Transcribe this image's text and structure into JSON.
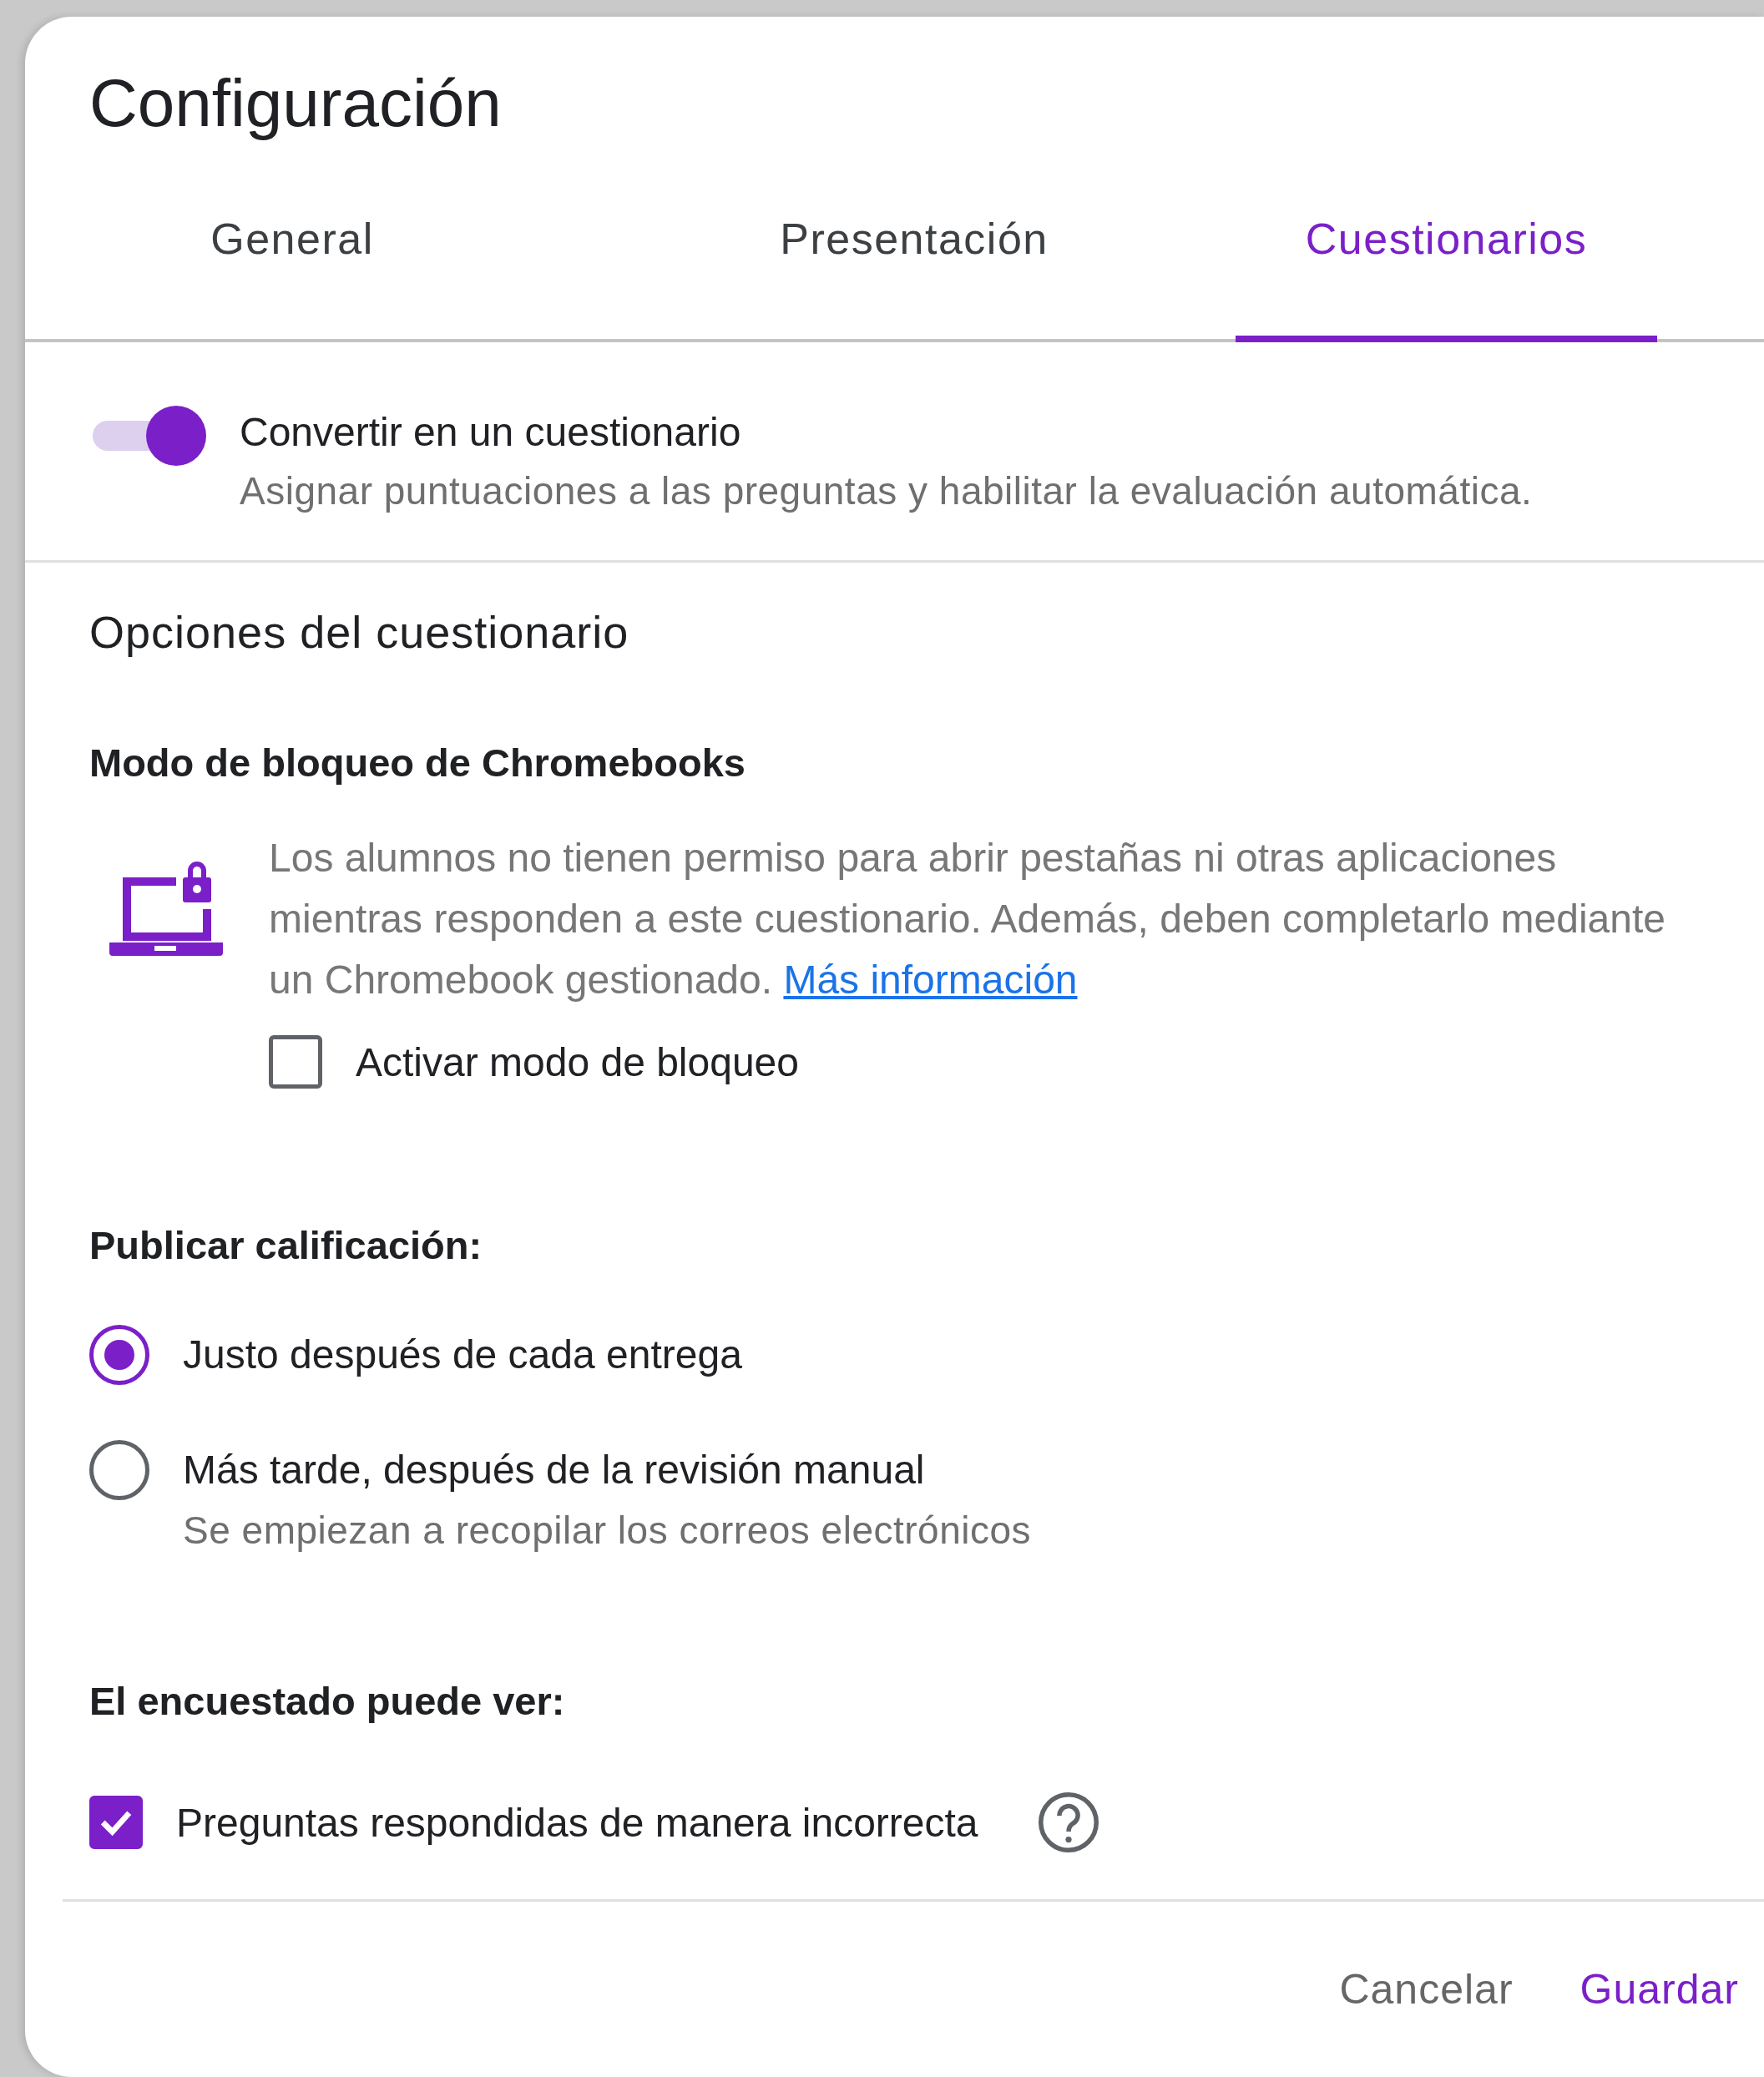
{
  "dialog": {
    "title": "Configuración"
  },
  "tabs": [
    {
      "label": "General",
      "selected": false
    },
    {
      "label": "Presentación",
      "selected": false
    },
    {
      "label": "Cuestionarios",
      "selected": true
    }
  ],
  "quiz_toggle": {
    "label": "Convertir en un cuestionario",
    "description": "Asignar puntuaciones a las preguntas y habilitar la evaluación automática.",
    "on": true
  },
  "section_title": "Opciones del cuestionario",
  "lockdown": {
    "heading": "Modo de bloqueo de Chromebooks",
    "description": "Los alumnos no tienen permiso para abrir pestañas ni otras aplicaciones mientras responden a este cuestionario. Además, deben completarlo mediante un Chromebook gestionado.",
    "link": "Más información",
    "checkbox": {
      "label": "Activar modo de bloqueo",
      "checked": false
    }
  },
  "release_grade": {
    "heading": "Publicar calificación:",
    "options": [
      {
        "label": "Justo después de cada entrega",
        "selected": true
      },
      {
        "label": "Más tarde, después de la revisión manual",
        "sublabel": "Se empiezan a recopilar los correos electrónicos",
        "selected": false
      }
    ]
  },
  "respondent_can_see": {
    "heading": "El encuestado puede ver:",
    "items": [
      {
        "label": "Preguntas respondidas de manera incorrecta",
        "checked": true
      }
    ]
  },
  "footer_buttons": [
    {
      "label": "Cancelar",
      "kind": "secondary"
    },
    {
      "label": "Guardar",
      "kind": "primary"
    }
  ]
}
